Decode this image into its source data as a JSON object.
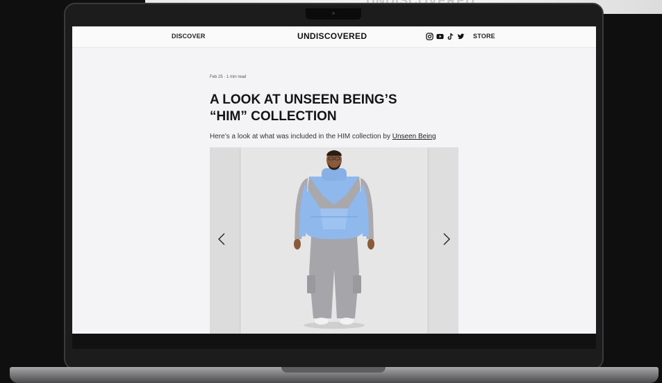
{
  "background": {
    "partial_brand_text": "UNDISCOVERED"
  },
  "site": {
    "nav_left": "DISCOVER",
    "brand": "UNDISCOVERED",
    "social_icons": [
      "instagram-icon",
      "youtube-icon",
      "tiktok-icon",
      "twitter-icon"
    ],
    "nav_right": "STORE"
  },
  "article": {
    "date": "Feb 25",
    "separator": "·",
    "read_time": "1 min read",
    "title_line1": "A LOOK AT UNSEEN BEING’S",
    "title_line2": "“HIM” COLLECTION",
    "subtitle_prefix": "Here’s a look at what was included in the HIM collection by ",
    "subtitle_link": "Unseen Being"
  },
  "carousel": {
    "prev_icon": "chevron-left-icon",
    "next_icon": "chevron-right-icon"
  },
  "colors": {
    "jacket_blue": "#8fb8ec",
    "panel_grey": "#a9a8ad",
    "page_bg": "#f4f4f7"
  }
}
